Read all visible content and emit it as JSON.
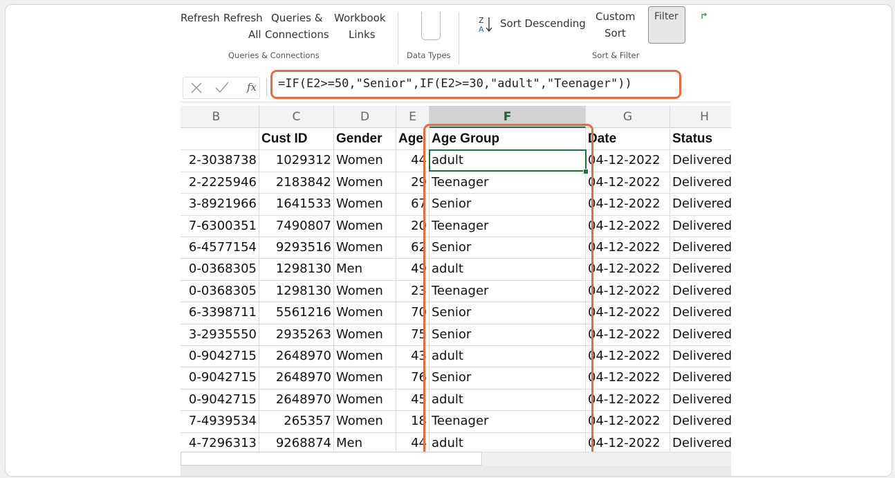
{
  "ribbon": {
    "refresh_label": "Refresh",
    "refresh_all_line1": "Refresh",
    "refresh_all_line2": "All",
    "queries_line1": "Queries &",
    "queries_line2": "Connections",
    "workbook_line1": "Workbook",
    "workbook_line2": "Links",
    "group_queries": "Queries & Connections",
    "group_datatypes": "Data Types",
    "sort_desc_label": "Sort Descending",
    "custom_sort_line1": "Custom",
    "custom_sort_line2": "Sort",
    "filter_label": "Filter",
    "group_sort": "Sort & Filter"
  },
  "formula_bar": {
    "fx_label": "fx",
    "formula": "=IF(E2>=50,\"Senior\",IF(E2>=30,\"adult\",\"Teenager\"))"
  },
  "columns": [
    "B",
    "C",
    "D",
    "E",
    "F",
    "G",
    "H"
  ],
  "header_row": [
    "",
    "Cust ID",
    "Gender",
    "Age",
    "Age Group",
    "Date",
    "Status"
  ],
  "rows": [
    [
      "2-3038738",
      "1029312",
      "Women",
      "44",
      "adult",
      "04-12-2022",
      "Delivered"
    ],
    [
      "2-2225946",
      "2183842",
      "Women",
      "29",
      "Teenager",
      "04-12-2022",
      "Delivered"
    ],
    [
      "3-8921966",
      "1641533",
      "Women",
      "67",
      "Senior",
      "04-12-2022",
      "Delivered"
    ],
    [
      "7-6300351",
      "7490807",
      "Women",
      "20",
      "Teenager",
      "04-12-2022",
      "Delivered"
    ],
    [
      "6-4577154",
      "9293516",
      "Women",
      "62",
      "Senior",
      "04-12-2022",
      "Delivered"
    ],
    [
      "0-0368305",
      "1298130",
      "Men",
      "49",
      "adult",
      "04-12-2022",
      "Delivered"
    ],
    [
      "0-0368305",
      "1298130",
      "Women",
      "23",
      "Teenager",
      "04-12-2022",
      "Delivered"
    ],
    [
      "6-3398711",
      "5561216",
      "Women",
      "70",
      "Senior",
      "04-12-2022",
      "Delivered"
    ],
    [
      "3-2935550",
      "2935263",
      "Women",
      "75",
      "Senior",
      "04-12-2022",
      "Delivered"
    ],
    [
      "0-9042715",
      "2648970",
      "Women",
      "43",
      "adult",
      "04-12-2022",
      "Delivered"
    ],
    [
      "0-9042715",
      "2648970",
      "Women",
      "76",
      "Senior",
      "04-12-2022",
      "Delivered"
    ],
    [
      "0-9042715",
      "2648970",
      "Women",
      "45",
      "adult",
      "04-12-2022",
      "Delivered"
    ],
    [
      "7-4939534",
      "265357",
      "Women",
      "18",
      "Teenager",
      "04-12-2022",
      "Delivered"
    ],
    [
      "4-7296313",
      "9268874",
      "Men",
      "44",
      "adult",
      "04-12-2022",
      "Delivered"
    ]
  ],
  "colors": {
    "highlight": "#ef6a3a",
    "excel_green": "#217346"
  }
}
